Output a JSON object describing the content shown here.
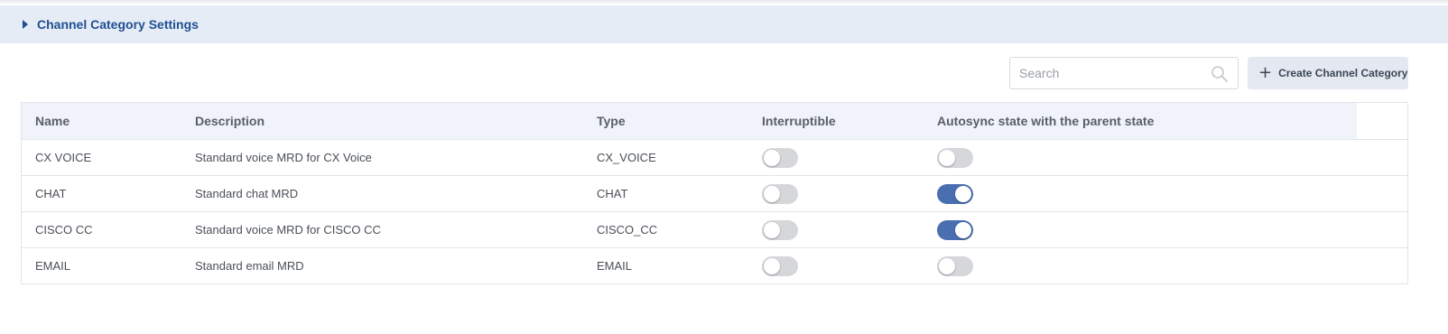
{
  "section": {
    "title": "Channel Category Settings"
  },
  "search": {
    "placeholder": "Search",
    "value": ""
  },
  "create_button": {
    "label": "Create Channel Category"
  },
  "table": {
    "columns": [
      "Name",
      "Description",
      "Type",
      "Interruptible",
      "Autosync state with the parent state"
    ],
    "rows": [
      {
        "name": "CX VOICE",
        "description": "Standard voice MRD for CX Voice",
        "type": "CX_VOICE",
        "interruptible": false,
        "autosync": false
      },
      {
        "name": "CHAT",
        "description": "Standard chat MRD",
        "type": "CHAT",
        "interruptible": false,
        "autosync": true
      },
      {
        "name": "CISCO CC",
        "description": "Standard voice MRD for CISCO CC",
        "type": "CISCO_CC",
        "interruptible": false,
        "autosync": true
      },
      {
        "name": "EMAIL",
        "description": "Standard email MRD",
        "type": "EMAIL",
        "interruptible": false,
        "autosync": false
      }
    ]
  },
  "colors": {
    "accent": "#1f4f93",
    "toggle_on": "#4a6fb0",
    "toggle_off": "#d5d7db",
    "header_bg": "#e6ecf5"
  }
}
